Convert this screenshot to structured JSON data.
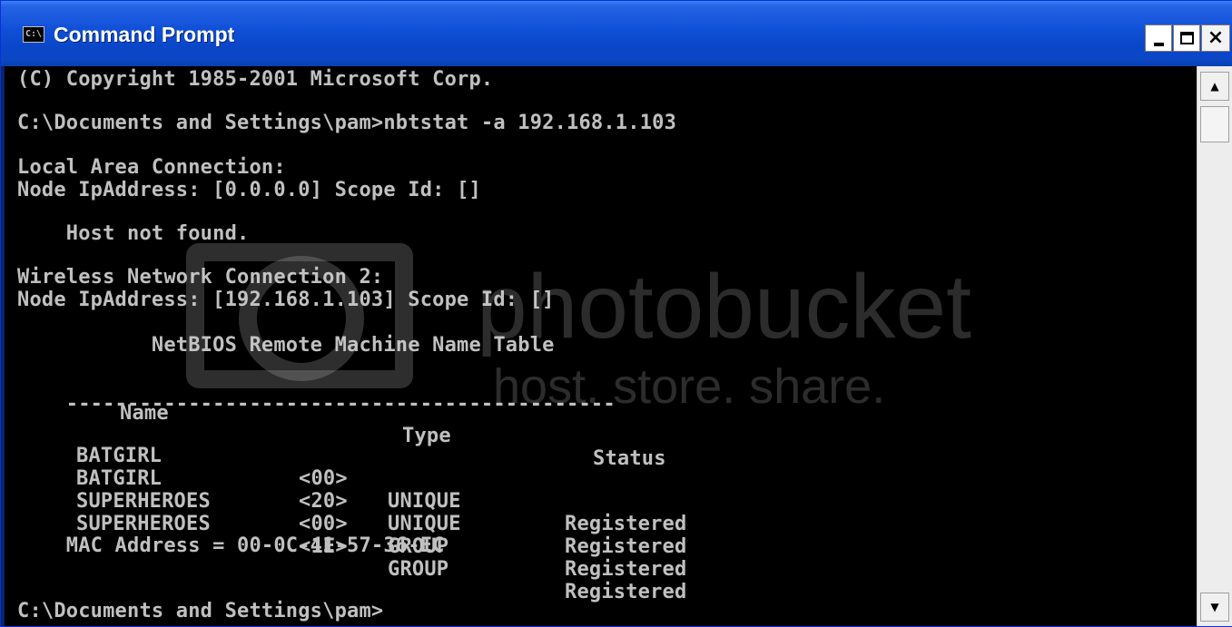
{
  "window": {
    "title": "Command Prompt",
    "icon_text": "C:\\",
    "icon": "console-icon",
    "controls": {
      "minimize": "minimize-icon",
      "maximize": "maximize-icon",
      "close_glyph": "×"
    }
  },
  "console": {
    "lines": {
      "copyright": "(C) Copyright 1985-2001 Microsoft Corp.",
      "command": "C:\\Documents and Settings\\pam>nbtstat -a 192.168.1.103",
      "lan_header": "Local Area Connection:",
      "lan_node": "Node IpAddress: [0.0.0.0] Scope Id: []",
      "host_not_found": "    Host not found.",
      "wireless_header": "Wireless Network Connection 2:",
      "wireless_node": "Node IpAddress: [192.168.1.103] Scope Id: []",
      "table_title": "           NetBIOS Remote Machine Name Table",
      "divider": "    ---------------------------------------------",
      "mac": "    MAC Address = 00-0C-41-57-36-EC",
      "prompt": "C:\\Documents and Settings\\pam>"
    },
    "table_headers": {
      "name": "Name",
      "type": "Type",
      "status": "Status"
    },
    "rows": [
      {
        "name": "BATGIRL",
        "code": "<00>",
        "type": "UNIQUE",
        "status": "Registered"
      },
      {
        "name": "BATGIRL",
        "code": "<20>",
        "type": "UNIQUE",
        "status": "Registered"
      },
      {
        "name": "SUPERHEROES",
        "code": "<00>",
        "type": "GROUP",
        "status": "Registered"
      },
      {
        "name": "SUPERHEROES",
        "code": "<1E>",
        "type": "GROUP",
        "status": "Registered"
      }
    ]
  },
  "watermark": {
    "brand": "photobucket",
    "tagline": "host. store. share."
  },
  "scrollbar": {
    "up_glyph": "▲",
    "down_glyph": "▼"
  },
  "colors": {
    "titlebar": "#0a46c9",
    "console_bg": "#000000",
    "console_text": "#c0c0c0"
  }
}
